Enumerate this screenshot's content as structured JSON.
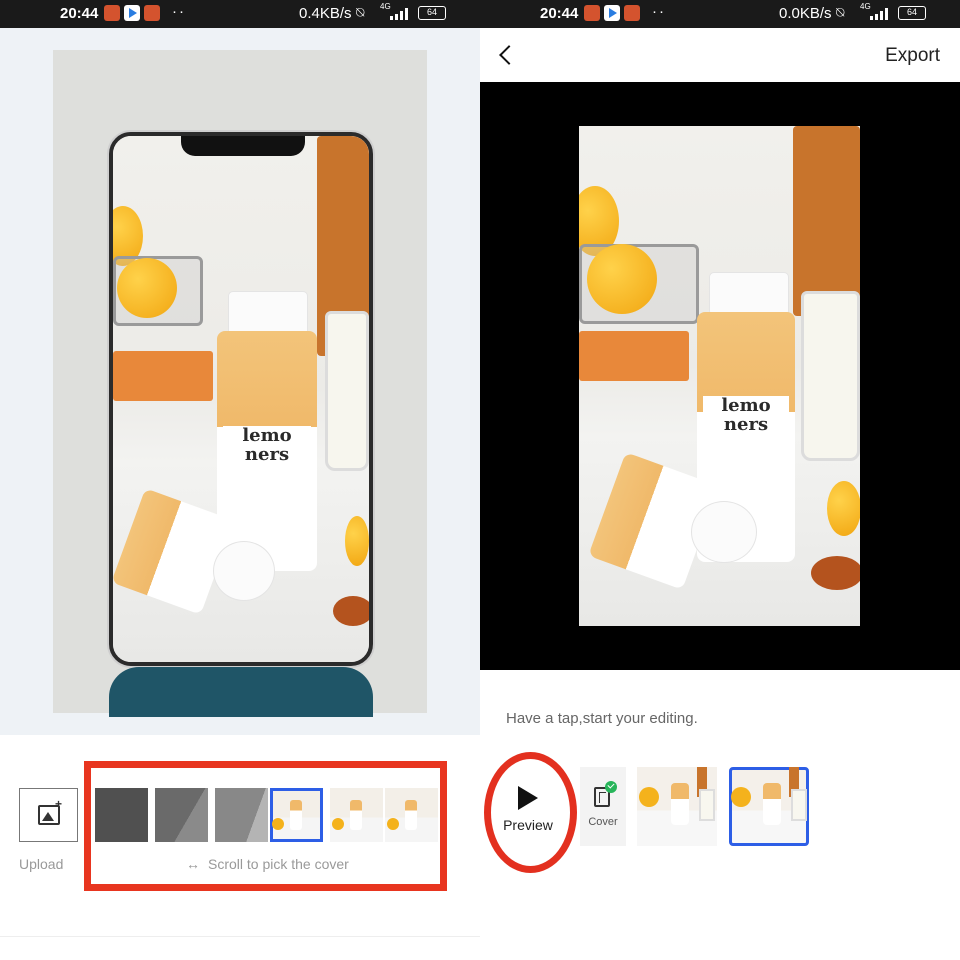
{
  "left_screen": {
    "status_bar": {
      "time": "20:44",
      "speed": "0.4KB/s",
      "network": "4G",
      "battery": "64"
    },
    "poster_brand": "lemo ners",
    "upload_label": "Upload",
    "scroll_hint": "Scroll to pick the cover",
    "scroll_hint_icon": "↔"
  },
  "right_screen": {
    "status_bar": {
      "time": "20:44",
      "speed": "0.0KB/s",
      "network": "4G",
      "battery": "64"
    },
    "export_label": "Export",
    "product_brand": "lemo ners",
    "hint": "Have a tap,start your editing.",
    "preview_label": "Preview",
    "cover_label": "Cover"
  },
  "colors": {
    "highlight": "#e8351f",
    "selection": "#2d5ee6",
    "check": "#27b55a"
  }
}
